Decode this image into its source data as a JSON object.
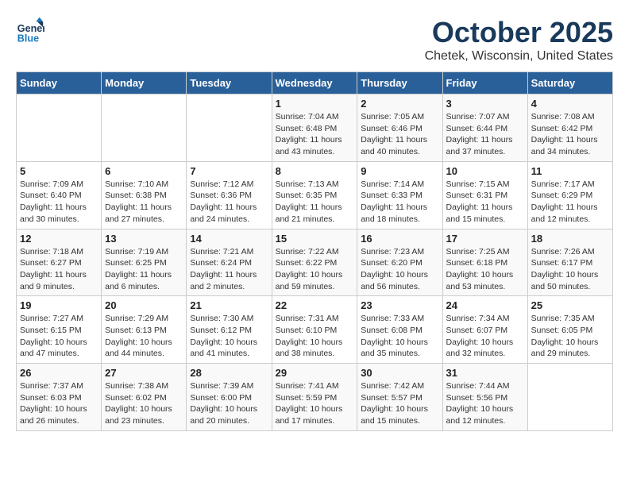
{
  "header": {
    "logo_line1": "General",
    "logo_line2": "Blue",
    "month": "October 2025",
    "location": "Chetek, Wisconsin, United States"
  },
  "days_of_week": [
    "Sunday",
    "Monday",
    "Tuesday",
    "Wednesday",
    "Thursday",
    "Friday",
    "Saturday"
  ],
  "weeks": [
    [
      {
        "day": "",
        "info": ""
      },
      {
        "day": "",
        "info": ""
      },
      {
        "day": "",
        "info": ""
      },
      {
        "day": "1",
        "info": "Sunrise: 7:04 AM\nSunset: 6:48 PM\nDaylight: 11 hours\nand 43 minutes."
      },
      {
        "day": "2",
        "info": "Sunrise: 7:05 AM\nSunset: 6:46 PM\nDaylight: 11 hours\nand 40 minutes."
      },
      {
        "day": "3",
        "info": "Sunrise: 7:07 AM\nSunset: 6:44 PM\nDaylight: 11 hours\nand 37 minutes."
      },
      {
        "day": "4",
        "info": "Sunrise: 7:08 AM\nSunset: 6:42 PM\nDaylight: 11 hours\nand 34 minutes."
      }
    ],
    [
      {
        "day": "5",
        "info": "Sunrise: 7:09 AM\nSunset: 6:40 PM\nDaylight: 11 hours\nand 30 minutes."
      },
      {
        "day": "6",
        "info": "Sunrise: 7:10 AM\nSunset: 6:38 PM\nDaylight: 11 hours\nand 27 minutes."
      },
      {
        "day": "7",
        "info": "Sunrise: 7:12 AM\nSunset: 6:36 PM\nDaylight: 11 hours\nand 24 minutes."
      },
      {
        "day": "8",
        "info": "Sunrise: 7:13 AM\nSunset: 6:35 PM\nDaylight: 11 hours\nand 21 minutes."
      },
      {
        "day": "9",
        "info": "Sunrise: 7:14 AM\nSunset: 6:33 PM\nDaylight: 11 hours\nand 18 minutes."
      },
      {
        "day": "10",
        "info": "Sunrise: 7:15 AM\nSunset: 6:31 PM\nDaylight: 11 hours\nand 15 minutes."
      },
      {
        "day": "11",
        "info": "Sunrise: 7:17 AM\nSunset: 6:29 PM\nDaylight: 11 hours\nand 12 minutes."
      }
    ],
    [
      {
        "day": "12",
        "info": "Sunrise: 7:18 AM\nSunset: 6:27 PM\nDaylight: 11 hours\nand 9 minutes."
      },
      {
        "day": "13",
        "info": "Sunrise: 7:19 AM\nSunset: 6:25 PM\nDaylight: 11 hours\nand 6 minutes."
      },
      {
        "day": "14",
        "info": "Sunrise: 7:21 AM\nSunset: 6:24 PM\nDaylight: 11 hours\nand 2 minutes."
      },
      {
        "day": "15",
        "info": "Sunrise: 7:22 AM\nSunset: 6:22 PM\nDaylight: 10 hours\nand 59 minutes."
      },
      {
        "day": "16",
        "info": "Sunrise: 7:23 AM\nSunset: 6:20 PM\nDaylight: 10 hours\nand 56 minutes."
      },
      {
        "day": "17",
        "info": "Sunrise: 7:25 AM\nSunset: 6:18 PM\nDaylight: 10 hours\nand 53 minutes."
      },
      {
        "day": "18",
        "info": "Sunrise: 7:26 AM\nSunset: 6:17 PM\nDaylight: 10 hours\nand 50 minutes."
      }
    ],
    [
      {
        "day": "19",
        "info": "Sunrise: 7:27 AM\nSunset: 6:15 PM\nDaylight: 10 hours\nand 47 minutes."
      },
      {
        "day": "20",
        "info": "Sunrise: 7:29 AM\nSunset: 6:13 PM\nDaylight: 10 hours\nand 44 minutes."
      },
      {
        "day": "21",
        "info": "Sunrise: 7:30 AM\nSunset: 6:12 PM\nDaylight: 10 hours\nand 41 minutes."
      },
      {
        "day": "22",
        "info": "Sunrise: 7:31 AM\nSunset: 6:10 PM\nDaylight: 10 hours\nand 38 minutes."
      },
      {
        "day": "23",
        "info": "Sunrise: 7:33 AM\nSunset: 6:08 PM\nDaylight: 10 hours\nand 35 minutes."
      },
      {
        "day": "24",
        "info": "Sunrise: 7:34 AM\nSunset: 6:07 PM\nDaylight: 10 hours\nand 32 minutes."
      },
      {
        "day": "25",
        "info": "Sunrise: 7:35 AM\nSunset: 6:05 PM\nDaylight: 10 hours\nand 29 minutes."
      }
    ],
    [
      {
        "day": "26",
        "info": "Sunrise: 7:37 AM\nSunset: 6:03 PM\nDaylight: 10 hours\nand 26 minutes."
      },
      {
        "day": "27",
        "info": "Sunrise: 7:38 AM\nSunset: 6:02 PM\nDaylight: 10 hours\nand 23 minutes."
      },
      {
        "day": "28",
        "info": "Sunrise: 7:39 AM\nSunset: 6:00 PM\nDaylight: 10 hours\nand 20 minutes."
      },
      {
        "day": "29",
        "info": "Sunrise: 7:41 AM\nSunset: 5:59 PM\nDaylight: 10 hours\nand 17 minutes."
      },
      {
        "day": "30",
        "info": "Sunrise: 7:42 AM\nSunset: 5:57 PM\nDaylight: 10 hours\nand 15 minutes."
      },
      {
        "day": "31",
        "info": "Sunrise: 7:44 AM\nSunset: 5:56 PM\nDaylight: 10 hours\nand 12 minutes."
      },
      {
        "day": "",
        "info": ""
      }
    ]
  ]
}
